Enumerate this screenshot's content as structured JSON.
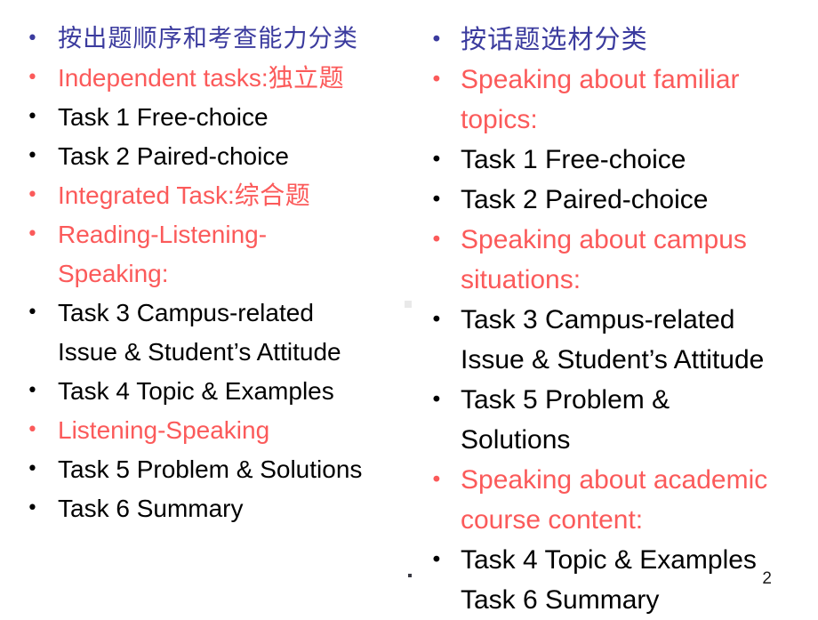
{
  "slide": {
    "background_color": "#ffffff",
    "page_number": "2",
    "colors": {
      "black": "#000000",
      "red": "#fb5a5a",
      "blue": "#3b3b9e"
    }
  },
  "left_column": {
    "items": [
      {
        "id": "left-heading-cjk",
        "color": "blue",
        "script": "cjk",
        "lines": [
          "按出题顺序和考查能力分类"
        ]
      },
      {
        "id": "left-independent-tasks",
        "color": "red",
        "latin_part": "Independent tasks:",
        "cjk_part": "独立题",
        "lines": [
          "Independent tasks:独立题"
        ]
      },
      {
        "id": "left-task-1",
        "color": "black",
        "lines": [
          "Task 1  Free-choice"
        ]
      },
      {
        "id": "left-task-2",
        "color": "black",
        "lines": [
          "Task 2 Paired-choice"
        ]
      },
      {
        "id": "left-integrated-task",
        "color": "red",
        "latin_part": "Integrated Task:",
        "cjk_part": "综合题",
        "lines": [
          "Integrated Task:综合题"
        ]
      },
      {
        "id": "left-reading-listening-speaking",
        "color": "red",
        "lines": [
          "Reading-Listening-",
          "Speaking:"
        ]
      },
      {
        "id": "left-task-3",
        "color": "black",
        "lines": [
          "Task 3 Campus-related",
          "Issue & Student’s Attitude"
        ]
      },
      {
        "id": "left-task-4",
        "color": "black",
        "lines": [
          "Task 4 Topic & Examples"
        ]
      },
      {
        "id": "left-listening-speaking",
        "color": "red",
        "lines": [
          "Listening-Speaking"
        ]
      },
      {
        "id": "left-task-5",
        "color": "black",
        "lines": [
          "Task 5 Problem & Solutions"
        ]
      },
      {
        "id": "left-task-6",
        "color": "black",
        "lines": [
          "Task 6 Summary"
        ]
      }
    ]
  },
  "right_column": {
    "items": [
      {
        "id": "right-heading-cjk",
        "color": "blue",
        "script": "cjk",
        "lines": [
          "按话题选材分类"
        ]
      },
      {
        "id": "right-familiar-topics",
        "color": "red",
        "lines": [
          "Speaking about familiar",
          "topics:"
        ]
      },
      {
        "id": "right-task-1",
        "color": "black",
        "lines": [
          "Task 1  Free-choice"
        ]
      },
      {
        "id": "right-task-2",
        "color": "black",
        "lines": [
          "Task 2 Paired-choice"
        ]
      },
      {
        "id": "right-campus-situations",
        "color": "red",
        "lines": [
          "Speaking about campus",
          "situations:"
        ]
      },
      {
        "id": "right-task-3",
        "color": "black",
        "lines": [
          "Task 3 Campus-related",
          "Issue & Student’s Attitude"
        ]
      },
      {
        "id": "right-task-5",
        "color": "black",
        "lines": [
          "Task 5 Problem &",
          "Solutions"
        ]
      },
      {
        "id": "right-academic-course-content",
        "color": "red",
        "lines": [
          "Speaking about academic",
          "course content:"
        ]
      },
      {
        "id": "right-task-4-and-6",
        "color": "black",
        "lines": [
          "Task 4 Topic & Examples",
          "Task 6 Summary"
        ]
      }
    ]
  },
  "bullet_glyph": "•"
}
